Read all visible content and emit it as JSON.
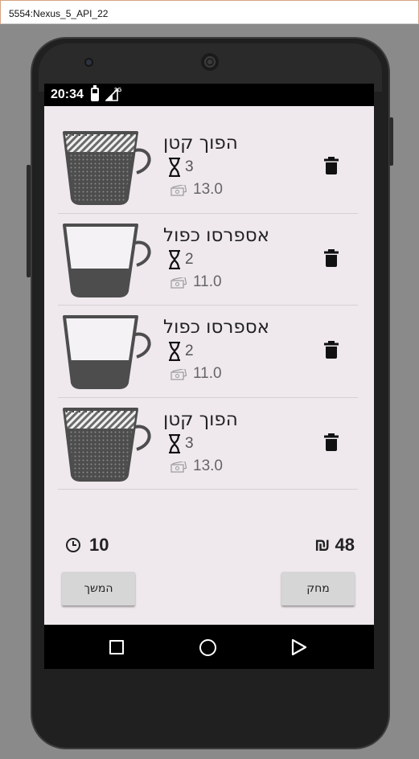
{
  "window": {
    "title": "5554:Nexus_5_API_22"
  },
  "status_bar": {
    "time": "20:34",
    "network": "3G"
  },
  "orders": [
    {
      "name": "הפוך קטן",
      "time": "3",
      "price": "13.0",
      "cup": "latte-cup-icon"
    },
    {
      "name": "אספרסו כפול",
      "time": "2",
      "price": "11.0",
      "cup": "espresso-cup-icon"
    },
    {
      "name": "אספרסו כפול",
      "time": "2",
      "price": "11.0",
      "cup": "espresso-cup-icon"
    },
    {
      "name": "הפוך קטן",
      "time": "3",
      "price": "13.0",
      "cup": "latte-cup-icon"
    }
  ],
  "summary": {
    "total_time": "10",
    "total_price": "48 ₪"
  },
  "buttons": {
    "continue_label": "המשך",
    "delete_label": "מחק"
  },
  "colors": {
    "app_background": "#efe9ee",
    "cup_dark": "#4d4d4d",
    "button": "#d6d6d6"
  }
}
